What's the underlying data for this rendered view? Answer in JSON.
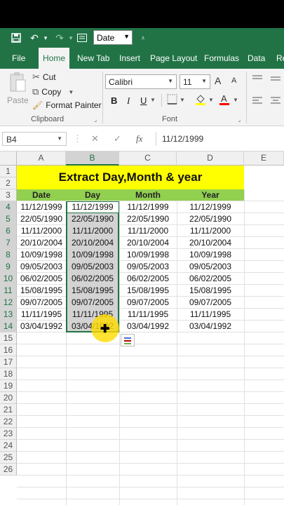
{
  "qat": {
    "format_combo": "Date"
  },
  "tabs": [
    "File",
    "Home",
    "New Tab",
    "Insert",
    "Page Layout",
    "Formulas",
    "Data",
    "Re"
  ],
  "ribbon": {
    "clipboard": {
      "paste": "Paste",
      "cut": "Cut",
      "copy": "Copy",
      "format_painter": "Format Painter",
      "label": "Clipboard"
    },
    "font": {
      "name": "Calibri",
      "size": "11",
      "bold": "B",
      "italic": "I",
      "underline": "U",
      "label": "Font",
      "grow": "A",
      "shrink": "A"
    }
  },
  "formula_bar": {
    "name_box": "B4",
    "value": "11/12/1999"
  },
  "columns": [
    "A",
    "B",
    "C",
    "D",
    "E"
  ],
  "rows": [
    "1",
    "2",
    "3",
    "4",
    "5",
    "6",
    "7",
    "8",
    "9",
    "10",
    "11",
    "12",
    "13",
    "14",
    "15",
    "16",
    "17",
    "18",
    "19",
    "20",
    "21",
    "22",
    "23",
    "24",
    "25",
    "26"
  ],
  "sheet": {
    "title": "Extract Day,Month & year",
    "headers": [
      "Date",
      "Day",
      "Month",
      "Year"
    ],
    "data": [
      [
        "11/12/1999",
        "11/12/1999",
        "11/12/1999",
        "11/12/1999"
      ],
      [
        "22/05/1990",
        "22/05/1990",
        "22/05/1990",
        "22/05/1990"
      ],
      [
        "11/11/2000",
        "11/11/2000",
        "11/11/2000",
        "11/11/2000"
      ],
      [
        "20/10/2004",
        "20/10/2004",
        "20/10/2004",
        "20/10/2004"
      ],
      [
        "10/09/1998",
        "10/09/1998",
        "10/09/1998",
        "10/09/1998"
      ],
      [
        "09/05/2003",
        "09/05/2003",
        "09/05/2003",
        "09/05/2003"
      ],
      [
        "06/02/2005",
        "06/02/2005",
        "06/02/2005",
        "06/02/2005"
      ],
      [
        "15/08/1995",
        "15/08/1995",
        "15/08/1995",
        "15/08/1995"
      ],
      [
        "09/07/2005",
        "09/07/2005",
        "09/07/2005",
        "09/07/2005"
      ],
      [
        "11/11/1995",
        "11/11/1995",
        "11/11/1995",
        "11/11/1995"
      ],
      [
        "03/04/1992",
        "03/04/1992",
        "03/04/1992",
        "03/04/1992"
      ]
    ]
  },
  "colors": {
    "excel_green": "#217346",
    "title_fill": "#ffff00",
    "header_fill": "#92d050",
    "selection": "#d3d3d3"
  }
}
